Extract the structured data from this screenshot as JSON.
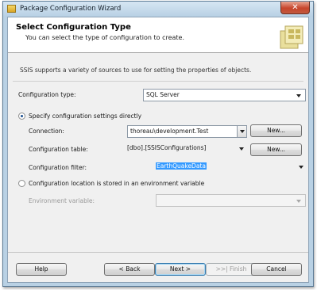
{
  "window": {
    "title": "Package Configuration Wizard",
    "close_glyph": "✕"
  },
  "header": {
    "title": "Select Configuration Type",
    "subtitle": "You can select the type of configuration to create.",
    "graphic_icon": "wizard-package-icon"
  },
  "intro": "SSIS supports a variety of sources to use for setting the properties of objects.",
  "configuration_type": {
    "label": "Configuration type:",
    "value": "SQL Server"
  },
  "direct_option": {
    "label": "Specify configuration settings directly",
    "checked": true,
    "connection": {
      "label": "Connection:",
      "value": "thoreau\\development.Test",
      "new_button": "New..."
    },
    "table": {
      "label": "Configuration table:",
      "value": "[dbo].[SSISConfigurations]",
      "new_button": "New..."
    },
    "filter": {
      "label": "Configuration filter:",
      "value": "EarthQuakeData"
    }
  },
  "env_option": {
    "label": "Configuration location is stored in an environment variable",
    "checked": false,
    "variable_label": "Environment variable:",
    "variable_value": ""
  },
  "buttons": {
    "help": "Help",
    "back": "< Back",
    "next": "Next >",
    "finish": ">>| Finish",
    "cancel": "Cancel"
  },
  "colors": {
    "selection": "#3399ff",
    "title_bar": "#b9d1e4",
    "close_button": "#c7452c"
  }
}
